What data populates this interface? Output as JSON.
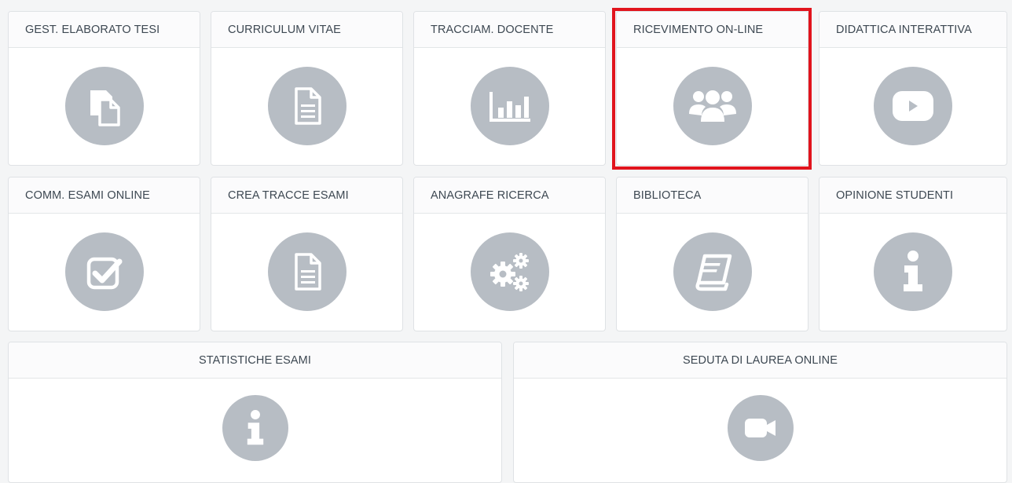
{
  "tiles": {
    "row1": [
      {
        "label": "GEST. ELABORATO TESI",
        "icon": "files-icon"
      },
      {
        "label": "CURRICULUM VITAE",
        "icon": "document-icon"
      },
      {
        "label": "TRACCIAM. DOCENTE",
        "icon": "bar-chart-icon"
      },
      {
        "label": "RICEVIMENTO ON-LINE",
        "icon": "users-group-icon"
      },
      {
        "label": "DIDATTICA INTERATTIVA",
        "icon": "play-video-icon"
      }
    ],
    "row2": [
      {
        "label": "COMM. ESAMI ONLINE",
        "icon": "checkbox-icon"
      },
      {
        "label": "CREA TRACCE ESAMI",
        "icon": "document-icon"
      },
      {
        "label": "ANAGRAFE RICERCA",
        "icon": "gears-icon"
      },
      {
        "label": "BIBLIOTECA",
        "icon": "book-icon"
      },
      {
        "label": "OPINIONE STUDENTI",
        "icon": "info-icon"
      }
    ],
    "row3": [
      {
        "label": "STATISTICHE ESAMI",
        "icon": "info-icon"
      },
      {
        "label": "SEDUTA DI LAUREA ONLINE",
        "icon": "video-camera-icon"
      }
    ]
  },
  "highlighted_tile": "RICEVIMENTO ON-LINE",
  "colors": {
    "icon_circle": "#b7bdc4",
    "icon_glyph": "#ffffff",
    "highlight": "#e1141d",
    "header_text": "#3d4852"
  }
}
